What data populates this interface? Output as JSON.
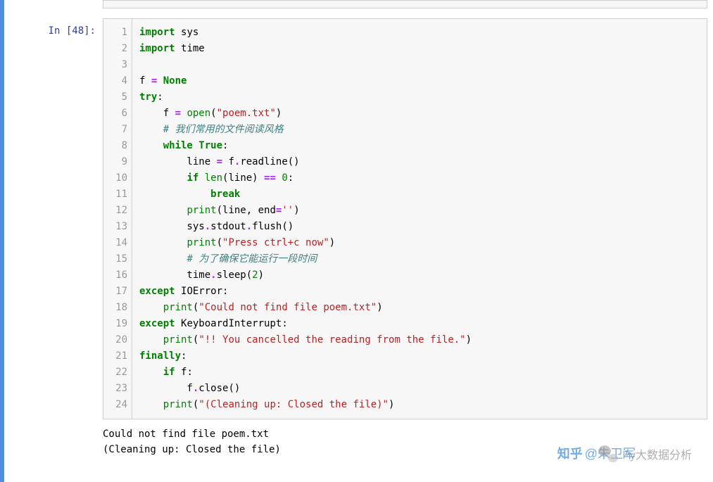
{
  "prompt": {
    "label": "In ",
    "number": "[48]:"
  },
  "code": {
    "lines": [
      [
        {
          "t": "import ",
          "c": "kw"
        },
        {
          "t": "sys",
          "c": "nn"
        }
      ],
      [
        {
          "t": "import ",
          "c": "kw"
        },
        {
          "t": "time",
          "c": "nn"
        }
      ],
      [],
      [
        {
          "t": "f ",
          "c": "nn"
        },
        {
          "t": "= ",
          "c": "op"
        },
        {
          "t": "None",
          "c": "bool"
        }
      ],
      [
        {
          "t": "try",
          "c": "kw"
        },
        {
          "t": ":",
          "c": "nn"
        }
      ],
      [
        {
          "t": "    f ",
          "c": "nn"
        },
        {
          "t": "= ",
          "c": "op"
        },
        {
          "t": "open",
          "c": "bi"
        },
        {
          "t": "(",
          "c": "nn"
        },
        {
          "t": "\"poem.txt\"",
          "c": "str"
        },
        {
          "t": ")",
          "c": "nn"
        }
      ],
      [
        {
          "t": "    ",
          "c": "nn"
        },
        {
          "t": "# 我们常用的文件阅读风格",
          "c": "cmt"
        }
      ],
      [
        {
          "t": "    ",
          "c": "nn"
        },
        {
          "t": "while ",
          "c": "kw"
        },
        {
          "t": "True",
          "c": "bool"
        },
        {
          "t": ":",
          "c": "nn"
        }
      ],
      [
        {
          "t": "        line ",
          "c": "nn"
        },
        {
          "t": "= ",
          "c": "op"
        },
        {
          "t": "f",
          "c": "nn"
        },
        {
          "t": ".",
          "c": "op"
        },
        {
          "t": "readline()",
          "c": "nn"
        }
      ],
      [
        {
          "t": "        ",
          "c": "nn"
        },
        {
          "t": "if ",
          "c": "kw"
        },
        {
          "t": "len",
          "c": "bi"
        },
        {
          "t": "(line) ",
          "c": "nn"
        },
        {
          "t": "== ",
          "c": "op"
        },
        {
          "t": "0",
          "c": "num"
        },
        {
          "t": ":",
          "c": "nn"
        }
      ],
      [
        {
          "t": "            ",
          "c": "nn"
        },
        {
          "t": "break",
          "c": "kw"
        }
      ],
      [
        {
          "t": "        ",
          "c": "nn"
        },
        {
          "t": "print",
          "c": "bi"
        },
        {
          "t": "(line, end",
          "c": "nn"
        },
        {
          "t": "=",
          "c": "op"
        },
        {
          "t": "''",
          "c": "str"
        },
        {
          "t": ")",
          "c": "nn"
        }
      ],
      [
        {
          "t": "        sys",
          "c": "nn"
        },
        {
          "t": ".",
          "c": "op"
        },
        {
          "t": "stdout",
          "c": "nn"
        },
        {
          "t": ".",
          "c": "op"
        },
        {
          "t": "flush()",
          "c": "nn"
        }
      ],
      [
        {
          "t": "        ",
          "c": "nn"
        },
        {
          "t": "print",
          "c": "bi"
        },
        {
          "t": "(",
          "c": "nn"
        },
        {
          "t": "\"Press ctrl+c now\"",
          "c": "str"
        },
        {
          "t": ")",
          "c": "nn"
        }
      ],
      [
        {
          "t": "        ",
          "c": "nn"
        },
        {
          "t": "# 为了确保它能运行一段时间",
          "c": "cmt"
        }
      ],
      [
        {
          "t": "        time",
          "c": "nn"
        },
        {
          "t": ".",
          "c": "op"
        },
        {
          "t": "sleep(",
          "c": "nn"
        },
        {
          "t": "2",
          "c": "num"
        },
        {
          "t": ")",
          "c": "nn"
        }
      ],
      [
        {
          "t": "except ",
          "c": "kw"
        },
        {
          "t": "IOError",
          "c": "nn"
        },
        {
          "t": ":",
          "c": "nn"
        }
      ],
      [
        {
          "t": "    ",
          "c": "nn"
        },
        {
          "t": "print",
          "c": "bi"
        },
        {
          "t": "(",
          "c": "nn"
        },
        {
          "t": "\"Could not find file poem.txt\"",
          "c": "str"
        },
        {
          "t": ")",
          "c": "nn"
        }
      ],
      [
        {
          "t": "except ",
          "c": "kw"
        },
        {
          "t": "KeyboardInterrupt",
          "c": "nn"
        },
        {
          "t": ":",
          "c": "nn"
        }
      ],
      [
        {
          "t": "    ",
          "c": "nn"
        },
        {
          "t": "print",
          "c": "bi"
        },
        {
          "t": "(",
          "c": "nn"
        },
        {
          "t": "\"!! You cancelled the reading from the file.\"",
          "c": "str"
        },
        {
          "t": ")",
          "c": "nn"
        }
      ],
      [
        {
          "t": "finally",
          "c": "kw"
        },
        {
          "t": ":",
          "c": "nn"
        }
      ],
      [
        {
          "t": "    ",
          "c": "nn"
        },
        {
          "t": "if ",
          "c": "kw"
        },
        {
          "t": "f:",
          "c": "nn"
        }
      ],
      [
        {
          "t": "        f",
          "c": "nn"
        },
        {
          "t": ".",
          "c": "op"
        },
        {
          "t": "close()",
          "c": "nn"
        }
      ],
      [
        {
          "t": "    ",
          "c": "nn"
        },
        {
          "t": "print",
          "c": "bi"
        },
        {
          "t": "(",
          "c": "nn"
        },
        {
          "t": "\"(Cleaning up: Closed the file)\"",
          "c": "str"
        },
        {
          "t": ")",
          "c": "nn"
        }
      ]
    ]
  },
  "output": {
    "lines": [
      "Could not find file poem.txt",
      "(Cleaning up: Closed the file)"
    ]
  },
  "watermark": {
    "right_text": "Py大数据分析",
    "zhihu_logo": "知乎",
    "zhihu_text": "@朱卫军"
  }
}
